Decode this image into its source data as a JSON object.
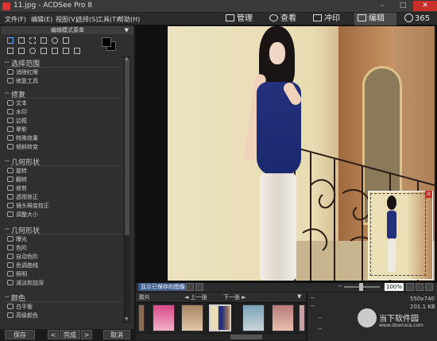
{
  "window": {
    "title": "11.jpg - ACDSee Pro 8",
    "min": "–",
    "max": "□",
    "close": "✕"
  },
  "menu": [
    "文件(F)",
    "编辑(E)",
    "视图(V)",
    "选择(S)",
    "工具(T)",
    "帮助(H)"
  ],
  "modes": [
    {
      "label": "管理",
      "icon": "grid-icon"
    },
    {
      "label": "查看",
      "icon": "eye-icon"
    },
    {
      "label": "冲印",
      "icon": "develop-icon"
    },
    {
      "label": "编辑",
      "icon": "edit-icon",
      "active": true
    }
  ],
  "counter": "365",
  "panel": {
    "header": "编辑模式菜单",
    "groups": [
      {
        "title": "选择范围",
        "items": [
          "消除红眼",
          "修复工具"
        ]
      },
      {
        "title": "修复",
        "items": [
          "文本",
          "水印",
          "边框",
          "晕影",
          "特殊效果",
          "倾斜转变"
        ]
      },
      {
        "title": "几何形状",
        "items": [
          "旋转",
          "翻转",
          "修剪",
          "透视修正",
          "镜头畸变校正",
          "调整大小"
        ]
      },
      {
        "title": "几何形状",
        "items": [
          "曝光",
          "色阶",
          "自动色阶",
          "色调曲线",
          "照明",
          "减淡和加深"
        ]
      },
      {
        "title": "颜色",
        "items": [
          "白平衡",
          "高级颜色"
        ]
      }
    ]
  },
  "buttons": {
    "save": "保存",
    "prev": "<",
    "done": "完成",
    "next": ">",
    "cancel": "取消"
  },
  "viewer": {
    "show_saved": "显示已保存的图像",
    "zoom": "100%"
  },
  "filmstrip": {
    "label": "胶片",
    "prev": "◄ 上一张",
    "next": "下一张 ►"
  },
  "info": {
    "dash1": "--",
    "dash2": "--",
    "size": "550x740",
    "version": "201.1 KB",
    "row1": "--",
    "row2": "--"
  },
  "watermark": {
    "brand": "当下软件园",
    "url": "www.downxia.com"
  }
}
